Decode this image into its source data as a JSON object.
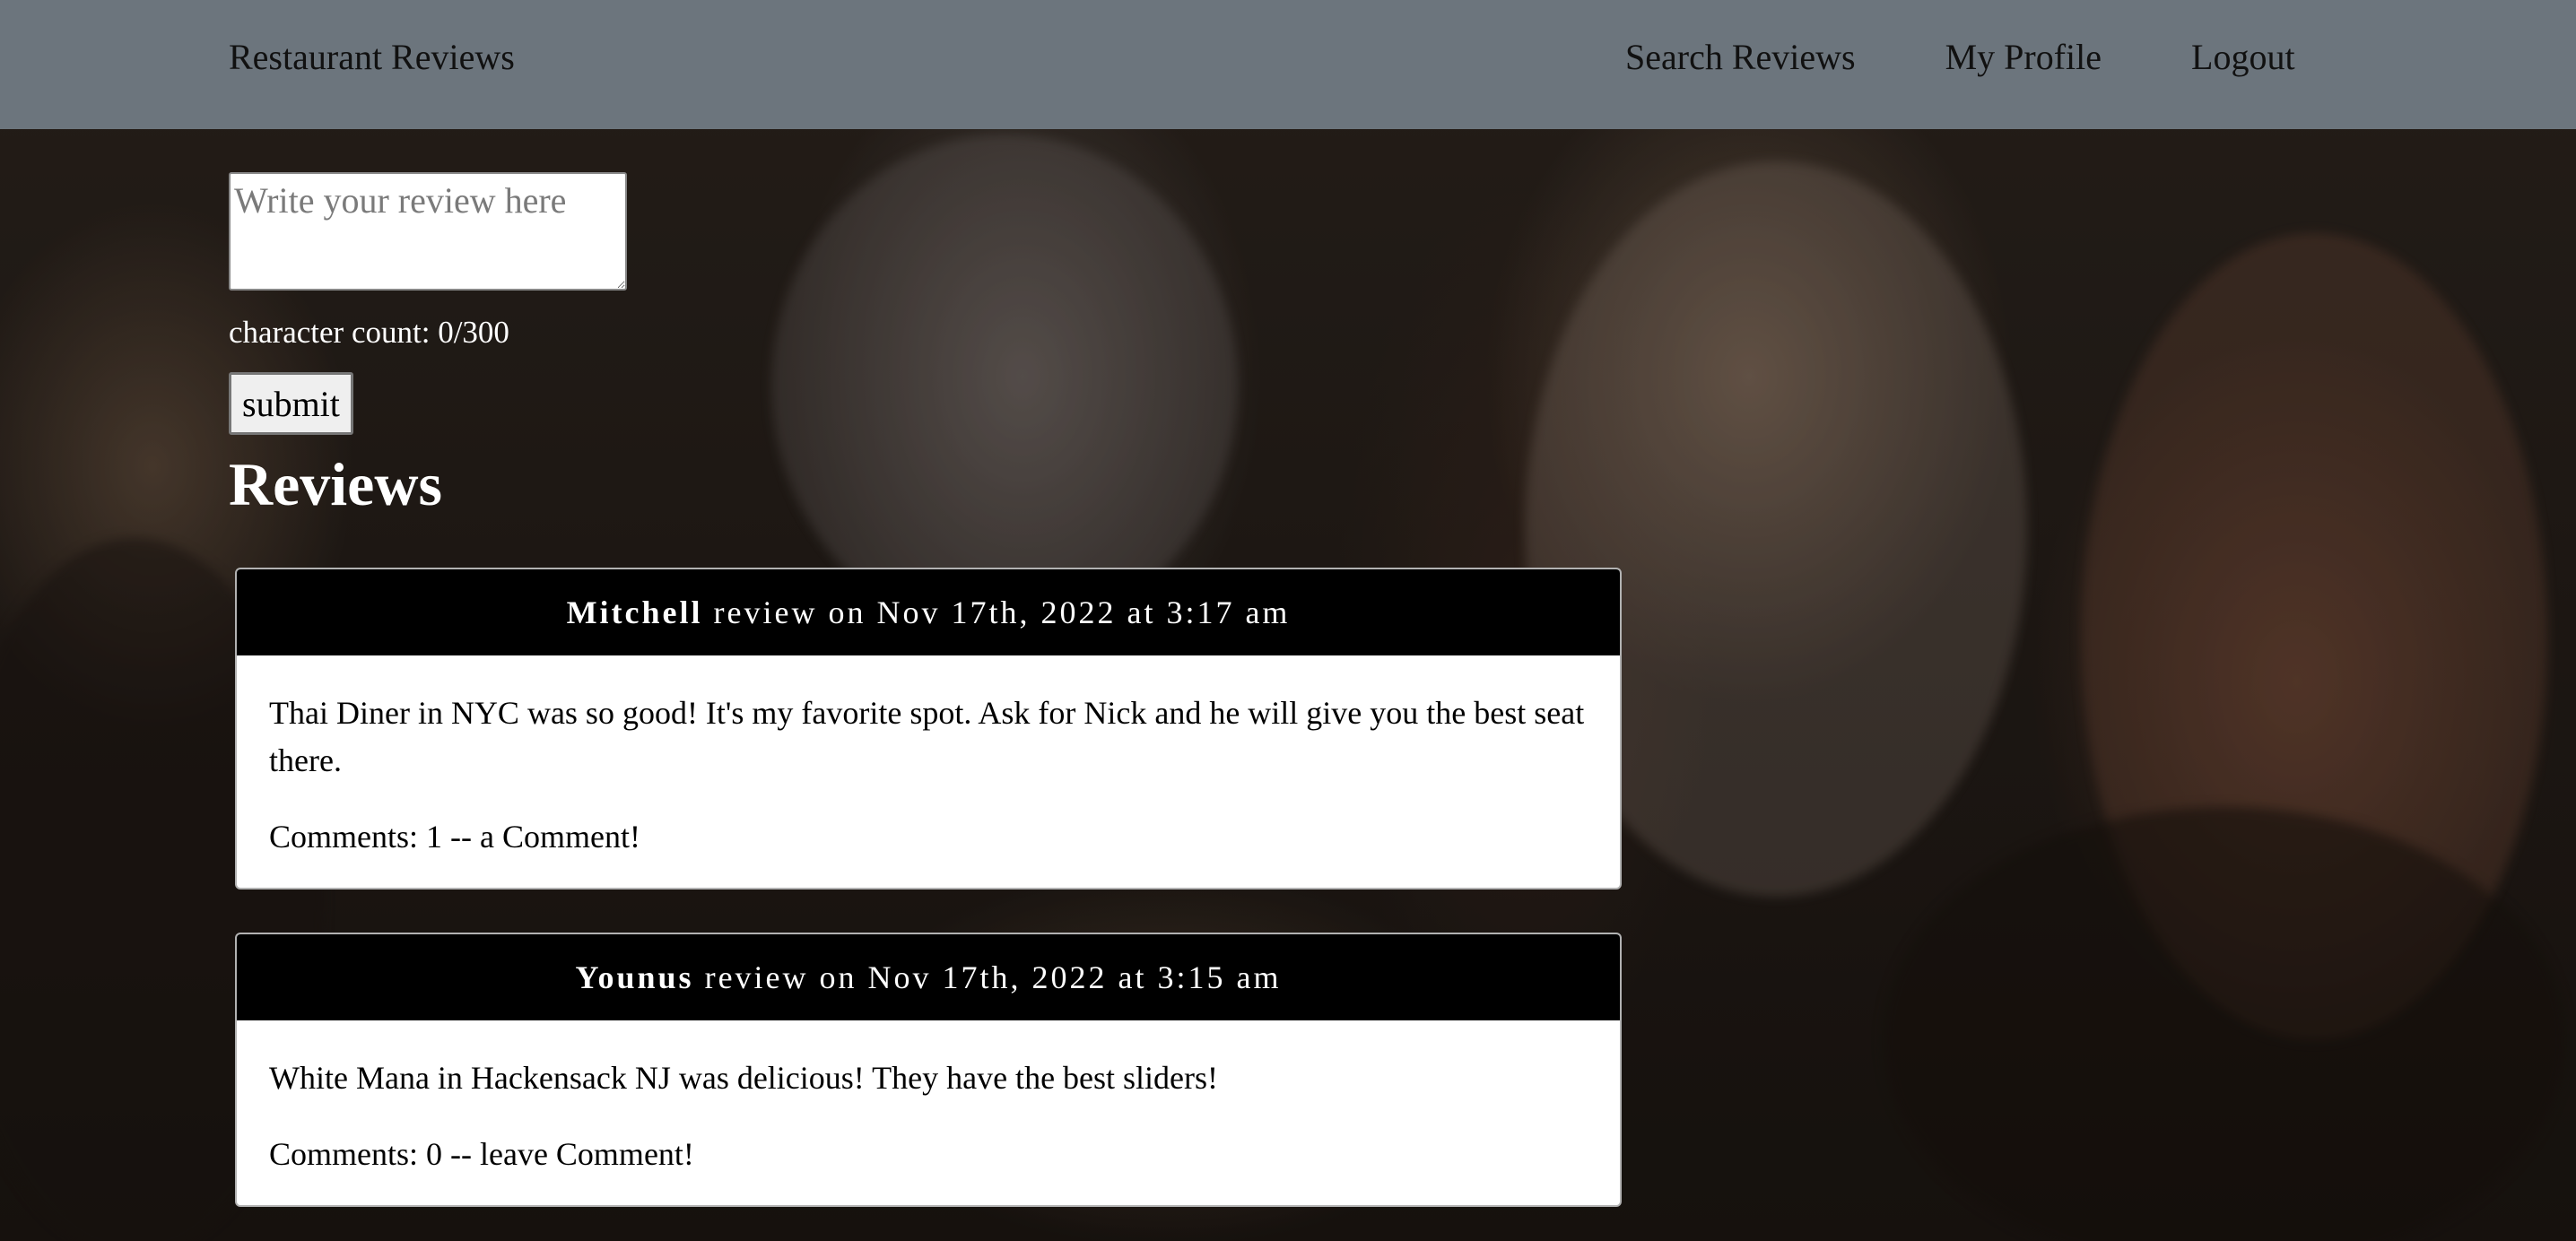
{
  "navbar": {
    "brand": "Restaurant Reviews",
    "links": {
      "search": "Search Reviews",
      "profile": "My Profile",
      "logout": "Logout"
    },
    "background_color": "#6c757d"
  },
  "review_form": {
    "placeholder": "Write your review here",
    "value": "",
    "character_count": "character count: 0/300",
    "submit_label": "submit"
  },
  "reviews_heading": "Reviews",
  "reviews": [
    {
      "author": "Mitchell",
      "meta": "review on Nov 17th, 2022 at 3:17 am",
      "text": "Thai Diner in NYC was so good! It's my favorite spot. Ask for Nick and he will give you the best seat there.",
      "comments": "Comments: 1 -- a Comment!"
    },
    {
      "author": "Younus",
      "meta": "review on Nov 17th, 2022 at 3:15 am",
      "text": "White Mana in Hackensack NJ was delicious! They have the best sliders!",
      "comments": "Comments: 0 -- leave Comment!"
    }
  ],
  "colors": {
    "card_header": "#000000",
    "card_body": "#ffffff",
    "heading_text": "#ffffff"
  }
}
